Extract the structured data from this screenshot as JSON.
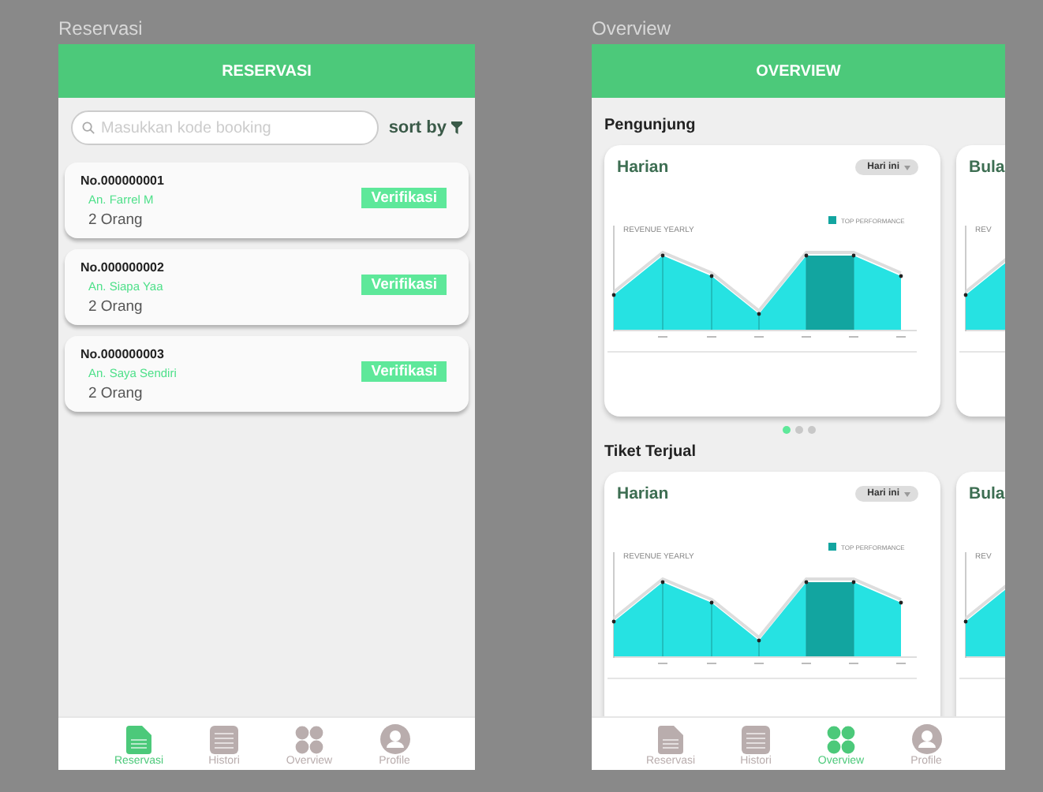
{
  "screens": [
    {
      "kind": "reservasi",
      "label": "Reservasi",
      "header": "RESERVASI",
      "search": {
        "placeholder": "Masukkan kode booking"
      },
      "sort_label": "sort by",
      "bookings": [
        {
          "number": "No.000000001",
          "name": "An. Farrel M",
          "guests": "2 Orang",
          "action": "Verifikasi"
        },
        {
          "number": "No.000000002",
          "name": "An. Siapa Yaa",
          "guests": "2 Orang",
          "action": "Verifikasi"
        },
        {
          "number": "No.000000003",
          "name": "An. Saya Sendiri",
          "guests": "2 Orang",
          "action": "Verifikasi"
        }
      ],
      "nav": [
        {
          "label": "Reservasi",
          "selected": true
        },
        {
          "label": "Histori",
          "selected": false
        },
        {
          "label": "Overview",
          "selected": false
        },
        {
          "label": "Profile",
          "selected": false
        }
      ]
    },
    {
      "kind": "overview",
      "label": "Overview",
      "header": "OVERVIEW",
      "sections": [
        {
          "title": "Pengunjung",
          "cards": [
            {
              "title": "Harian",
              "filter": "Hari ini",
              "chart_title": "REVENUE YEARLY",
              "legend": "TOP PERFORMANCE"
            },
            {
              "title": "Bula",
              "chart_title": "REV"
            }
          ],
          "pager": [
            {
              "selected": true
            },
            {
              "selected": false
            },
            {
              "selected": false
            }
          ]
        },
        {
          "title": "Tiket Terjual",
          "cards": [
            {
              "title": "Harian",
              "filter": "Hari ini",
              "chart_title": "REVENUE YEARLY",
              "legend": "TOP PERFORMANCE"
            },
            {
              "title": "Bula",
              "chart_title": "REV"
            }
          ]
        }
      ],
      "nav": [
        {
          "label": "Reservasi",
          "selected": false
        },
        {
          "label": "Histori",
          "selected": false
        },
        {
          "label": "Overview",
          "selected": true
        },
        {
          "label": "Profile",
          "selected": false
        }
      ]
    }
  ]
}
